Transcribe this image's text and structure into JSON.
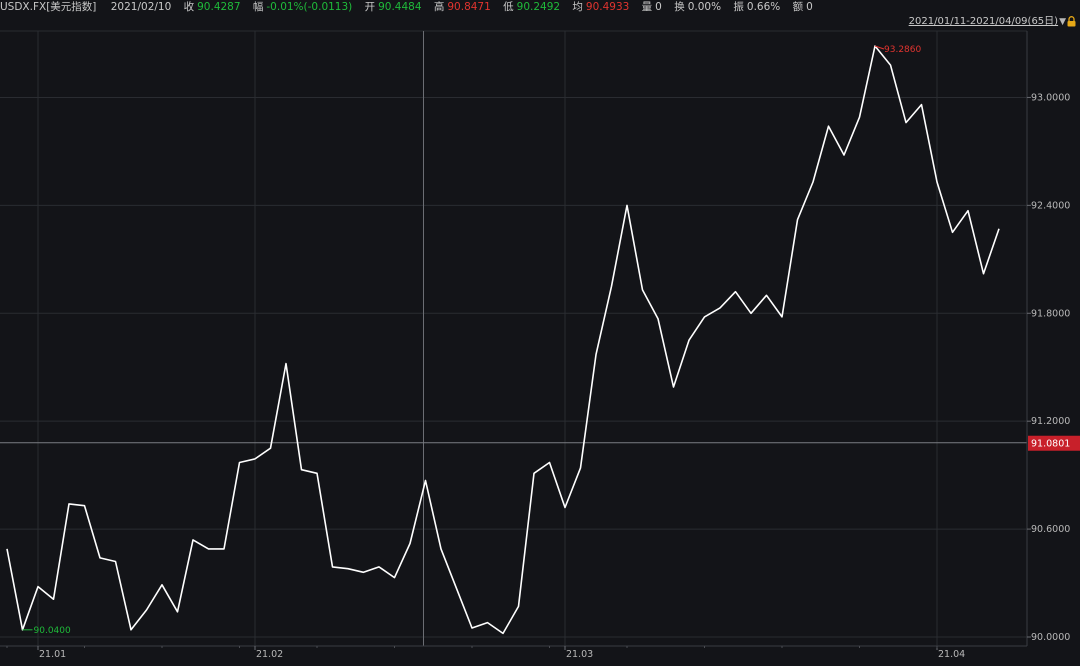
{
  "header": {
    "symbol": "USDX.FX[美元指数]",
    "date": "2021/02/10",
    "close_label": "收",
    "close": "90.4287",
    "change_label": "幅",
    "change": "-0.01%(-0.0113)",
    "open_label": "开",
    "open": "90.4484",
    "high_label": "高",
    "high": "90.8471",
    "low_label": "低",
    "low": "90.2492",
    "avg_label": "均",
    "avg": "90.4933",
    "volume_label": "量",
    "volume": "0",
    "turnover_label": "换",
    "turnover": "0.00%",
    "amplitude_label": "振",
    "amplitude": "0.66%",
    "amount_label": "额",
    "amount": "0",
    "range": "2021/01/11-2021/04/09(65日)",
    "range_icon": "triangle-down-icon",
    "lock_icon": "lock-icon"
  },
  "colors": {
    "background": "#131418",
    "line": "#ffffff",
    "grid": "#2a2c31",
    "up": "#e0342f",
    "down": "#1fba3a",
    "current_price_bg": "#c8202a"
  },
  "chart_data": {
    "type": "line",
    "title": "",
    "xlabel": "",
    "ylabel": "",
    "ylim": [
      90.0,
      93.4
    ],
    "x_tick_labels": [
      "21.01",
      "21.02",
      "21.03",
      "21.04"
    ],
    "x_tick_index": [
      2,
      16,
      36,
      60
    ],
    "y_tick_labels": [
      "90.0000",
      "90.6000",
      "91.2000",
      "91.8000",
      "92.4000",
      "93.0000"
    ],
    "y_ticks": [
      90.0,
      90.6,
      91.2,
      91.8,
      92.4,
      93.0
    ],
    "grid": true,
    "crosshair_index": 27,
    "current_price": 91.0801,
    "current_price_label": "91.0801",
    "max_label": "93.2860",
    "min_label": "90.0400",
    "max_index": 56,
    "min_index": 1,
    "series": [
      {
        "values": [
          90.49,
          90.04,
          90.28,
          90.21,
          90.74,
          90.73,
          90.44,
          90.42,
          90.04,
          90.15,
          90.29,
          90.14,
          90.54,
          90.49,
          90.49,
          90.97,
          90.99,
          91.05,
          91.52,
          90.93,
          90.91,
          90.39,
          90.38,
          90.36,
          90.39,
          90.33,
          90.52,
          90.87,
          90.49,
          90.27,
          90.05,
          90.08,
          90.02,
          90.17,
          90.91,
          90.97,
          90.72,
          90.94,
          91.57,
          91.95,
          92.4,
          91.93,
          91.77,
          91.39,
          91.65,
          91.78,
          91.83,
          91.92,
          91.8,
          91.9,
          91.78,
          92.32,
          92.53,
          92.84,
          92.68,
          92.89,
          93.286,
          93.18,
          92.86,
          92.96,
          92.53,
          92.25,
          92.37,
          92.02,
          92.27
        ]
      }
    ]
  }
}
